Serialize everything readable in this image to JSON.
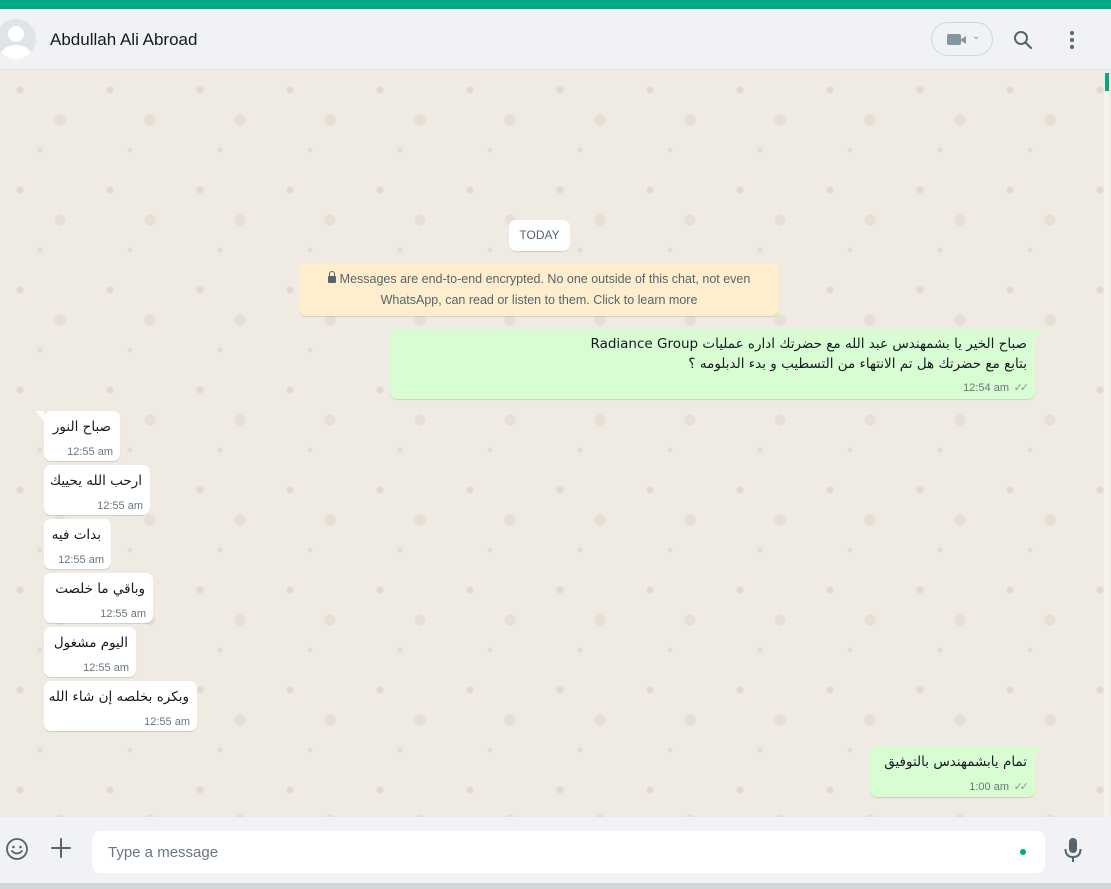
{
  "header": {
    "contact_name": "Abdullah Ali Abroad",
    "video_call_icon": "video-camera-icon",
    "search_icon": "search-icon",
    "menu_icon": "kebab-menu-icon"
  },
  "chat": {
    "date_label": "TODAY",
    "encryption_notice": "Messages are end-to-end encrypted. No one outside of this chat, not even WhatsApp, can read or listen to them. Click to learn more",
    "messages": [
      {
        "direction": "out",
        "lines": [
          "صباح الخير يا بشمهندس عبد الله مع  حضرتك اداره عمليات Radiance Group",
          "بتابع مع حضرتك هل تم الانتهاء من التسطيب و بدء الدبلومه ؟"
        ],
        "time": "12:54 am",
        "status": "read"
      },
      {
        "direction": "in",
        "lines": [
          "صباح النور"
        ],
        "time": "12:55 am"
      },
      {
        "direction": "in",
        "lines": [
          "ارحب الله يحييك"
        ],
        "time": "12:55 am"
      },
      {
        "direction": "in",
        "lines": [
          "بدات فيه"
        ],
        "time": "12:55 am"
      },
      {
        "direction": "in",
        "lines": [
          "وباقي ما خلصت"
        ],
        "time": "12:55 am"
      },
      {
        "direction": "in",
        "lines": [
          "اليوم مشغول"
        ],
        "time": "12:55 am"
      },
      {
        "direction": "in",
        "lines": [
          "وبكره بخلصه إن شاء الله"
        ],
        "time": "12:55 am"
      },
      {
        "direction": "out",
        "lines": [
          "تمام يابشمهندس بالتوفيق"
        ],
        "time": "1:00 am",
        "status": "read"
      }
    ]
  },
  "composer": {
    "placeholder": "Type a message",
    "emoji_icon": "emoji-icon",
    "attach_icon": "plus-icon",
    "mic_icon": "microphone-icon"
  },
  "colors": {
    "accent": "#00a884",
    "outgoing_bubble": "#d9fdd3",
    "incoming_bubble": "#ffffff",
    "notice_bg": "#ffeecd"
  }
}
